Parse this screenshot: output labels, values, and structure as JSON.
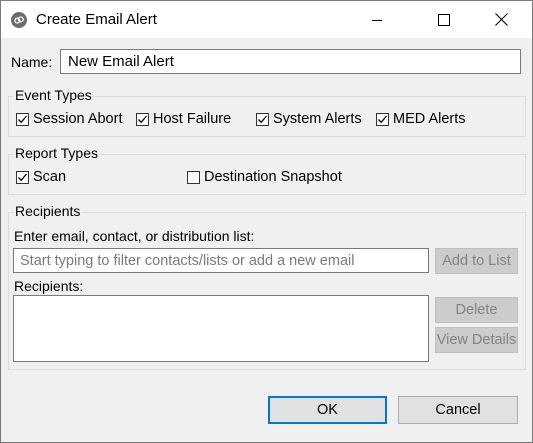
{
  "window": {
    "title": "Create Email Alert",
    "controls": {
      "minimize_icon": "minimize-icon",
      "maximize_icon": "maximize-icon",
      "close_icon": "close-icon"
    }
  },
  "name": {
    "label": "Name:",
    "value": "New Email Alert"
  },
  "event_types": {
    "title": "Event Types",
    "options": [
      {
        "label": "Session Abort",
        "checked": true
      },
      {
        "label": "Host Failure",
        "checked": true
      },
      {
        "label": "System Alerts",
        "checked": true
      },
      {
        "label": "MED Alerts",
        "checked": true
      }
    ]
  },
  "report_types": {
    "title": "Report Types",
    "options": [
      {
        "label": "Scan",
        "checked": true
      },
      {
        "label": "Destination Snapshot",
        "checked": false
      }
    ]
  },
  "recipients": {
    "title": "Recipients",
    "entry_label": "Enter email, contact, or distribution list:",
    "entry_placeholder": "Start typing to filter contacts/lists or add a new email",
    "entry_value": "",
    "add_button": "Add to List",
    "list_label": "Recipients:",
    "items": [],
    "delete_button": "Delete",
    "view_details_button": "View Details"
  },
  "footer": {
    "ok_button": "OK",
    "cancel_button": "Cancel"
  },
  "colors": {
    "default_button_border": "#0078d7",
    "disabled_button": "#cccccc",
    "title_bar": "#ffffff",
    "dialog_bg": "#f0f0f0"
  }
}
